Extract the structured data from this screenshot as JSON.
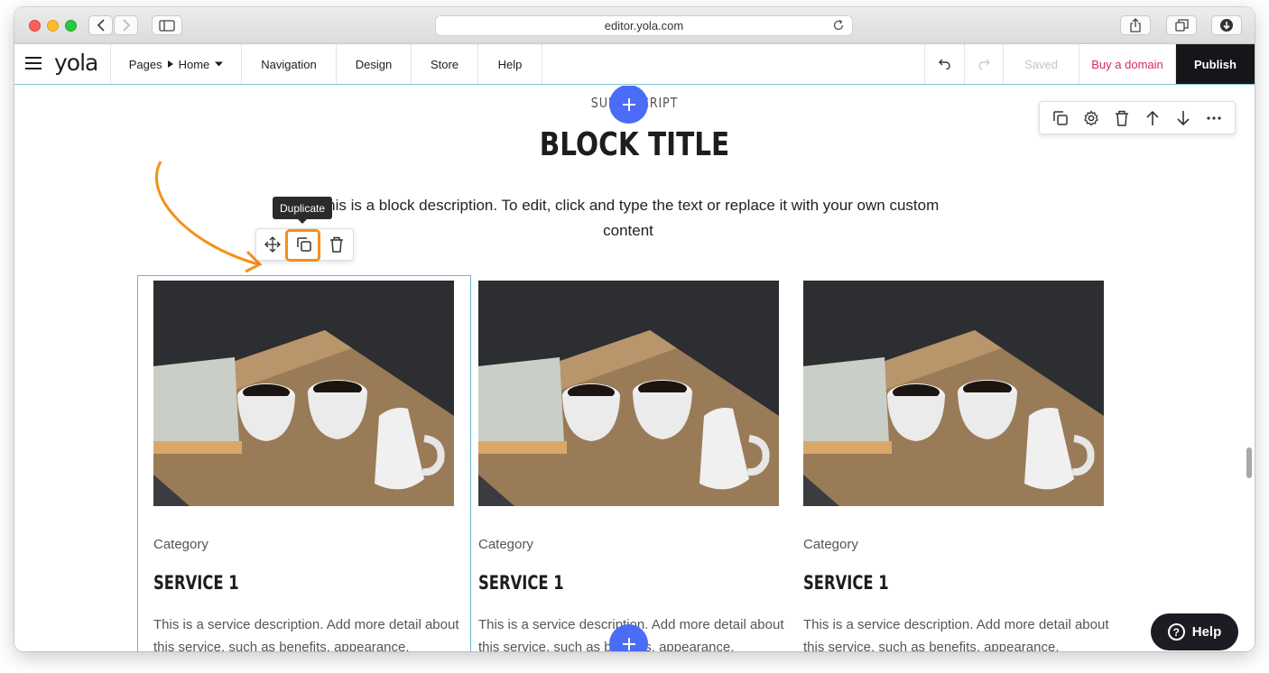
{
  "browser": {
    "url": "editor.yola.com"
  },
  "editor": {
    "logo": "yola",
    "pages_label": "Pages",
    "current_page": "Home",
    "nav_items": [
      "Navigation",
      "Design",
      "Store",
      "Help"
    ],
    "saved_label": "Saved",
    "buy_domain_label": "Buy a domain",
    "publish_label": "Publish"
  },
  "block": {
    "superscript": "SUPERSCRIPT",
    "title": "BLOCK TITLE",
    "description": "This is a block description. To edit, click and type the text or replace it with your own custom content"
  },
  "tooltip": {
    "label": "Duplicate"
  },
  "cards": [
    {
      "category": "Category",
      "title": "SERVICE 1",
      "description": "This is a service description. Add more detail about this service, such as benefits, appearance,"
    },
    {
      "category": "Category",
      "title": "SERVICE 1",
      "description": "This is a service description. Add more detail about this service, such as benefits, appearance,"
    },
    {
      "category": "Category",
      "title": "SERVICE 1",
      "description": "This is a service description. Add more detail about this service, such as benefits, appearance,"
    }
  ],
  "help_widget": {
    "label": "Help"
  },
  "colors": {
    "accent_blue": "#4a6cf7",
    "highlight_orange": "#f4901a",
    "buy_domain_pink": "#d52a5a",
    "publish_dark": "#14161a"
  },
  "icons": {
    "block_toolbar": [
      "duplicate-icon",
      "gear-icon",
      "trash-icon",
      "arrow-up-icon",
      "arrow-down-icon",
      "more-icon"
    ],
    "item_toolbar": [
      "move-icon",
      "duplicate-icon",
      "trash-icon"
    ]
  }
}
